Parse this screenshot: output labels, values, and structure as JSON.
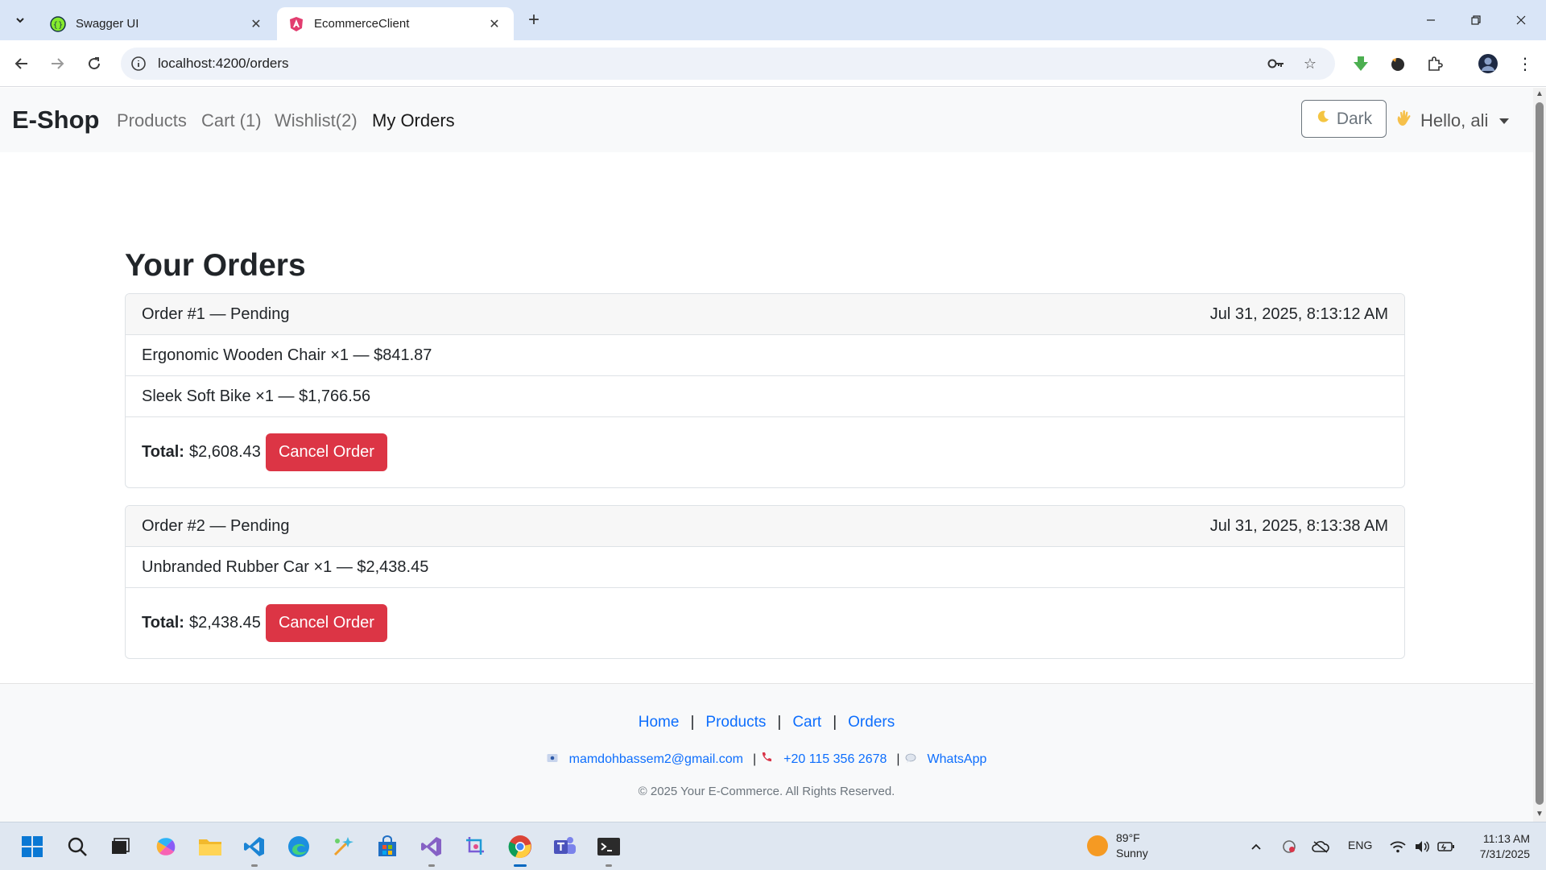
{
  "browser": {
    "tabs": [
      {
        "title": "Swagger UI",
        "active": false
      },
      {
        "title": "EcommerceClient",
        "active": true
      }
    ],
    "url": "localhost:4200/orders"
  },
  "navbar": {
    "brand": "E-Shop",
    "links": [
      "Products",
      "Cart (1)",
      "Wishlist(2)",
      "My Orders"
    ],
    "active_link": "My Orders",
    "theme_toggle": "Dark",
    "greeting": "Hello, ali"
  },
  "page": {
    "title": "Your Orders",
    "total_label": "Total:",
    "cancel_label": "Cancel Order",
    "orders": [
      {
        "header": "Order #1 — Pending",
        "date": "Jul 31, 2025, 8:13:12 AM",
        "items": [
          "Ergonomic Wooden Chair ×1 — $841.87",
          "Sleek Soft Bike ×1 — $1,766.56"
        ],
        "total": "$2,608.43"
      },
      {
        "header": "Order #2 — Pending",
        "date": "Jul 31, 2025, 8:13:38 AM",
        "items": [
          "Unbranded Rubber Car ×1 — $2,438.45"
        ],
        "total": "$2,438.45"
      }
    ]
  },
  "footer": {
    "links": [
      "Home",
      "Products",
      "Cart",
      "Orders"
    ],
    "email": "mamdohbassem2@gmail.com",
    "phone": "+20 115 356 2678",
    "whatsapp": "WhatsApp",
    "copyright": "© 2025 Your E-Commerce. All Rights Reserved."
  },
  "taskbar": {
    "weather_temp": "89°F",
    "weather_desc": "Sunny",
    "language": "ENG",
    "time": "11:13 AM",
    "date": "7/31/2025"
  },
  "colors": {
    "primary_link": "#0d6efd",
    "danger": "#dc3545",
    "navbar_bg": "#f8f9fa"
  }
}
